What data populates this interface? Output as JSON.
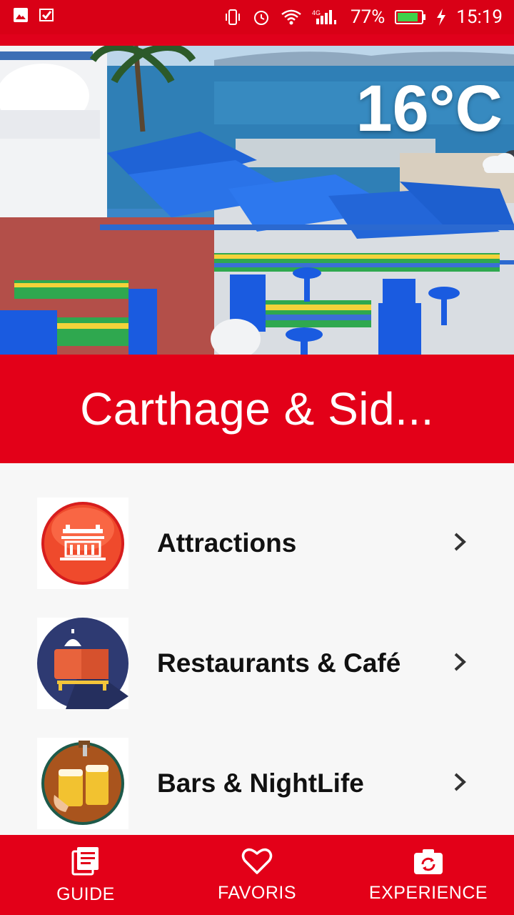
{
  "status_bar": {
    "battery": "77%",
    "time": "15:19",
    "network": "4G"
  },
  "hero": {
    "temperature": "16°C",
    "weather_icon": "cloudy-icon"
  },
  "banner": {
    "title": "Carthage & Sid..."
  },
  "categories": [
    {
      "label": "Attractions",
      "icon": "attractions-icon"
    },
    {
      "label": "Restaurants & Café",
      "icon": "restaurant-icon"
    },
    {
      "label": "Bars & NightLife",
      "icon": "beer-icon"
    }
  ],
  "bottom_nav": {
    "guide": "GUIDE",
    "favoris": "FAVORIS",
    "experience": "EXPERIENCE"
  },
  "colors": {
    "brand_red": "#e30018",
    "status_red": "#d90016"
  }
}
